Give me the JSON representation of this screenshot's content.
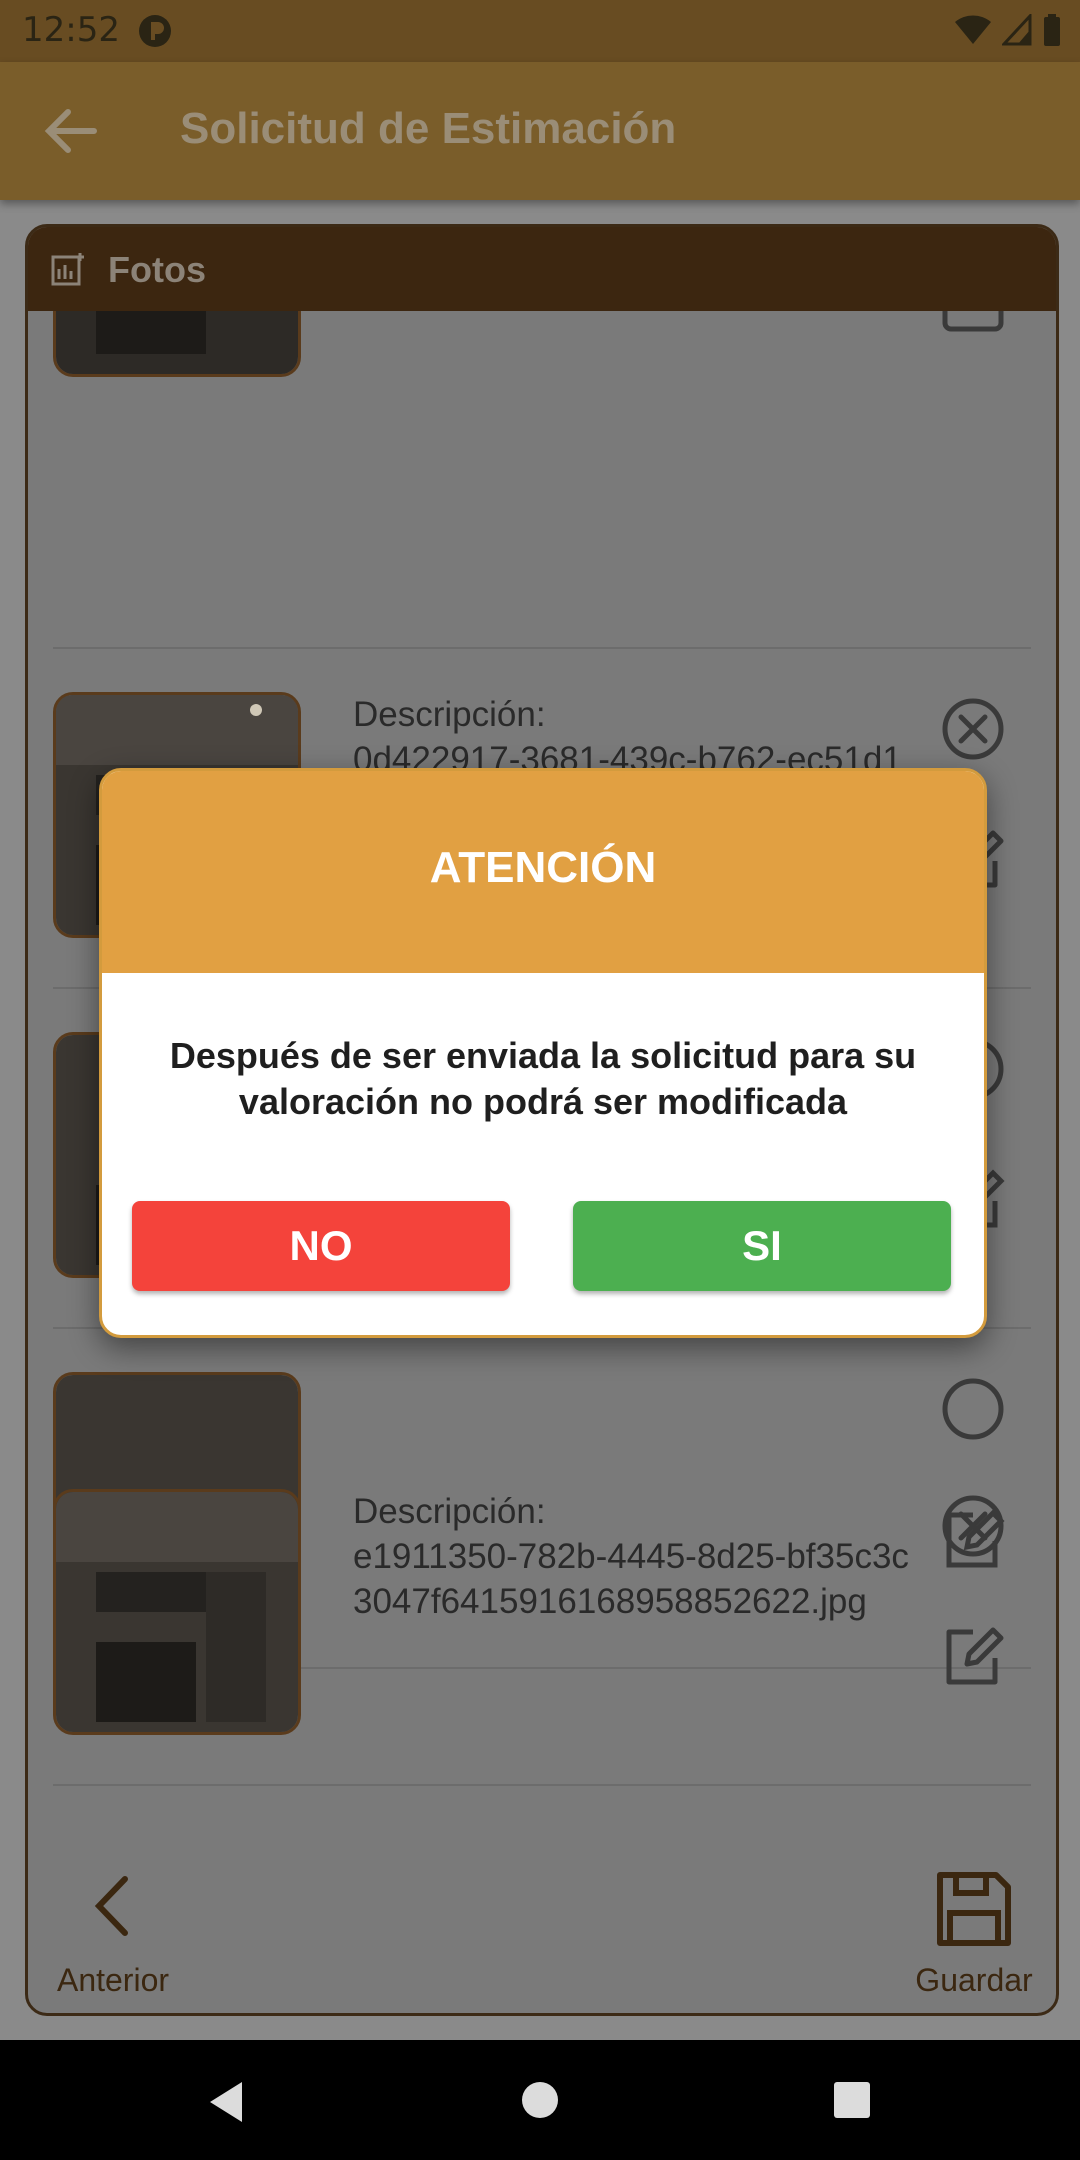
{
  "status_bar": {
    "time": "12:52"
  },
  "app_bar": {
    "title": "Solicitud de Estimación"
  },
  "card": {
    "header_title": "Fotos",
    "items": [
      {
        "label": "Descripción:",
        "filename": "0d422917-3681-439c-b762-ec51d19dbb4438568451586078933​91.jpg"
      },
      {
        "label": "Descripción:",
        "filename": "e1911350-782b-4445-8d25-bf35c3c3047f641591616895885262​2.jpg"
      }
    ]
  },
  "bottom_nav": {
    "prev_label": "Anterior",
    "save_label": "Guardar"
  },
  "dialog": {
    "title": "ATENCIÓN",
    "message": "Después de ser enviada la solicitud para su valoración no podrá ser modificada",
    "no_label": "NO",
    "yes_label": "SI"
  },
  "colors": {
    "app_bar": "#7a5d2a",
    "dialog_header": "#e1a042",
    "no_button": "#f4433b",
    "yes_button": "#4caf50"
  }
}
